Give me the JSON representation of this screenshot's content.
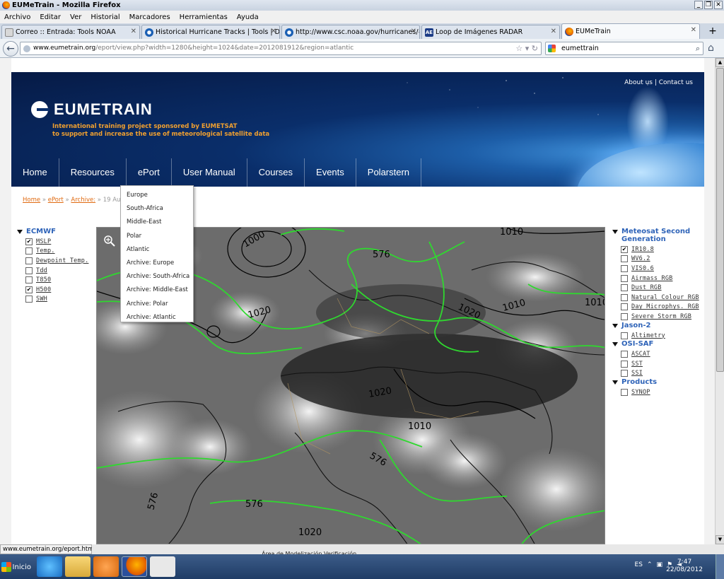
{
  "window": {
    "title": "EUMeTrain - Mozilla Firefox"
  },
  "menu": [
    "Archivo",
    "Editar",
    "Ver",
    "Historial",
    "Marcadores",
    "Herramientas",
    "Ayuda"
  ],
  "tabs": [
    {
      "label": "Correo :: Entrada: Tools NOAA",
      "icon": "mail-icon",
      "active": false
    },
    {
      "label": "Historical Hurricane Tracks | Tools | Digita...",
      "icon": "noaa-icon",
      "active": false
    },
    {
      "label": "http://www.csc.noaa.gov/hurricanes/#",
      "icon": "noaa-icon",
      "active": false
    },
    {
      "label": "Loop de Imágenes RADAR",
      "icon": "ae-icon",
      "active": false
    },
    {
      "label": "EUMeTrain",
      "icon": "firefox-icon",
      "active": true
    }
  ],
  "tab_icon_letter_ae": "AE",
  "url": {
    "domain": "www.eumetrain.org",
    "path": "/eport/view.php?width=1280&height=1024&date=2012081912&region=atlantic"
  },
  "search": {
    "value": "eumettrain"
  },
  "banner": {
    "logo": "EUMETRAIN",
    "tagline_1": "International training project sponsored by EUMETSAT",
    "tagline_2": "to support and increase the use of meteorological satellite data",
    "top_links": "About us | Contact us"
  },
  "nav": [
    "Home",
    "Resources",
    "ePort",
    "User Manual",
    "Courses",
    "Events",
    "Polarstern"
  ],
  "breadcrumb": {
    "home": "Home",
    "eport": "ePort",
    "archive": "Archive:",
    "sep": "»",
    "rest": "19 Augu"
  },
  "dropdown": [
    "Europe",
    "South-Africa",
    "Middle-East",
    "Polar",
    "Atlantic",
    "Archive: Europe",
    "Archive: South-Africa",
    "Archive: Middle-East",
    "Archive: Polar",
    "Archive: Atlantic"
  ],
  "left_panel": {
    "title": "ECMWF",
    "items": [
      {
        "label": "MSLP",
        "checked": true
      },
      {
        "label": "Temp.",
        "checked": false
      },
      {
        "label": "Dewpoint Temp.",
        "checked": false
      },
      {
        "label": "Tdd",
        "checked": false
      },
      {
        "label": "T850",
        "checked": false
      },
      {
        "label": "H500",
        "checked": true
      },
      {
        "label": "SWH",
        "checked": false
      }
    ]
  },
  "right_panel": {
    "groups": [
      {
        "title": "Meteosat Second Generation",
        "items": [
          {
            "label": "IR10.8",
            "checked": true
          },
          {
            "label": "WV6.2",
            "checked": false
          },
          {
            "label": "VIS0.6",
            "checked": false
          },
          {
            "label": "Airmass RGB",
            "checked": false
          },
          {
            "label": "Dust RGB",
            "checked": false
          },
          {
            "label": "Natural Colour RGB",
            "checked": false
          },
          {
            "label": "Day Microphys. RGB",
            "checked": false
          },
          {
            "label": "Severe Storm RGB",
            "checked": false
          }
        ]
      },
      {
        "title": "Jason-2",
        "items": [
          {
            "label": "Altimetry",
            "checked": false
          }
        ]
      },
      {
        "title": "OSI-SAF",
        "items": [
          {
            "label": "ASCAT",
            "checked": false
          },
          {
            "label": "SST",
            "checked": false
          },
          {
            "label": "SSI",
            "checked": false
          }
        ]
      },
      {
        "title": "Products",
        "items": [
          {
            "label": "SYNOP",
            "checked": false
          }
        ]
      }
    ]
  },
  "map_labels": [
    "1000",
    "1010",
    "576",
    "1020",
    "1020",
    "1010",
    "1020",
    "1010",
    "1010",
    "576",
    "576",
    "576",
    "1020"
  ],
  "status_url": "www.eumetrain.org/eport.html",
  "ghost_text": "Área de Modelización   Verificación",
  "taskbar": {
    "start": "Inicio",
    "lang": "ES",
    "time": "7:47",
    "date": "22/08/2012"
  },
  "colors": {
    "banner_dark": "#061a45",
    "nav_text": "#ffffff",
    "accent_orange": "#e06a10",
    "panel_title": "#2e63b8",
    "contour_green": "#2fd82f"
  }
}
